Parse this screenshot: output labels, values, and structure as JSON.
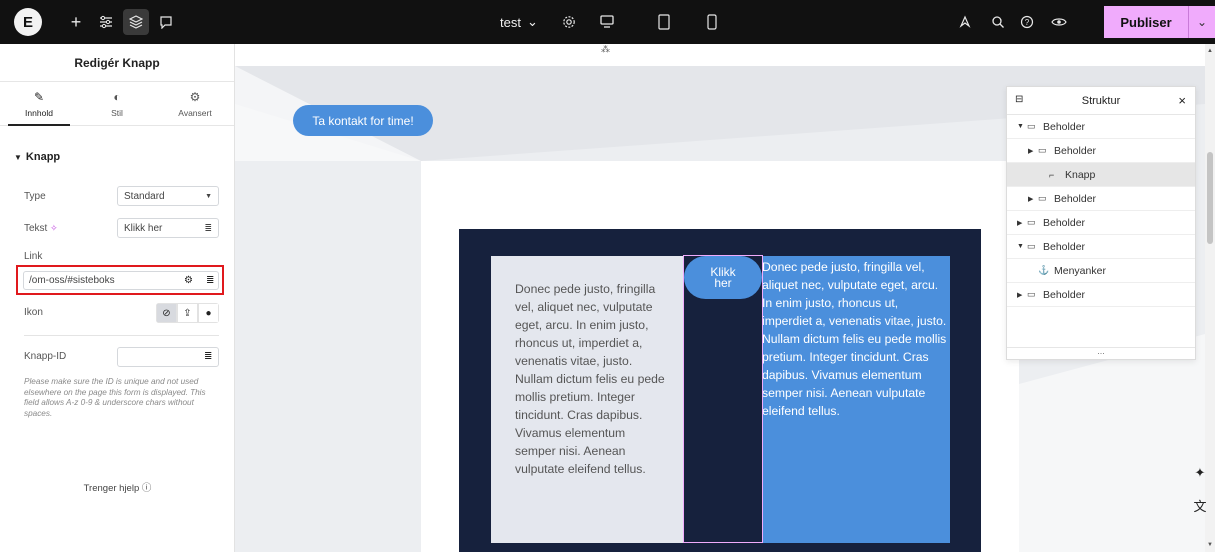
{
  "topbar": {
    "site_name": "test",
    "publish_label": "Publiser",
    "icons": [
      "elementor-logo-icon",
      "add-icon",
      "settings-sliders-icon",
      "layers-icon",
      "comments-icon",
      "gear-icon",
      "desktop-icon",
      "tablet-icon",
      "mobile-icon",
      "notes-icon",
      "search-icon",
      "help-icon",
      "preview-icon"
    ]
  },
  "panel": {
    "title": "Redigér Knapp",
    "tabs": [
      {
        "label": "Innhold",
        "icon": "pencil-icon"
      },
      {
        "label": "Stil",
        "icon": "half-circle-icon"
      },
      {
        "label": "Avansert",
        "icon": "gear-icon"
      }
    ],
    "section": "Knapp",
    "type_label": "Type",
    "type_value": "Standard",
    "tekst_label": "Tekst",
    "tekst_value": "Klikk her",
    "link_label": "Link",
    "link_value": "/om-oss/#sisteboks",
    "ikon_label": "Ikon",
    "knapp_id_label": "Knapp-ID",
    "hint": "Please make sure the ID is unique and not used elsewhere on the page this form is displayed. This field allows A-z 0-9 & underscore chars without spaces.",
    "help": "Trenger hjelp"
  },
  "canvas": {
    "cta_label": "Ta kontakt for time!",
    "klikk_label_line1": "Klikk",
    "klikk_label_line2": "her",
    "left_text": "Donec pede justo, fringilla vel, aliquet nec, vulputate eget, arcu. In enim justo, rhoncus ut, imperdiet a, venenatis vitae, justo. Nullam dictum felis eu pede mollis pretium. Integer tincidunt. Cras dapibus. Vivamus elementum semper nisi. Aenean vulputate eleifend tellus.",
    "right_text": "Donec pede justo, fringilla vel, aliquet nec, vulputate eget, arcu. In enim justo, rhoncus ut, imperdiet a, venenatis vitae, justo. Nullam dictum felis eu pede mollis pretium. Integer tincidunt. Cras dapibus. Vivamus elementum semper nisi. Aenean vulputate eleifend tellus."
  },
  "structure": {
    "title": "Struktur",
    "rows": [
      {
        "label": "Beholder",
        "indent": 0,
        "arrow": "down",
        "icon": "container-icon"
      },
      {
        "label": "Beholder",
        "indent": 1,
        "arrow": "right",
        "icon": "container-icon"
      },
      {
        "label": "Knapp",
        "indent": 2,
        "arrow": "",
        "icon": "button-icon",
        "selected": true
      },
      {
        "label": "Beholder",
        "indent": 1,
        "arrow": "right",
        "icon": "container-icon"
      },
      {
        "label": "Beholder",
        "indent": 0,
        "arrow": "right",
        "icon": "container-icon"
      },
      {
        "label": "Beholder",
        "indent": 0,
        "arrow": "down",
        "icon": "container-icon"
      },
      {
        "label": "Menyanker",
        "indent": 1,
        "arrow": "",
        "icon": "anchor-icon"
      },
      {
        "label": "Beholder",
        "indent": 0,
        "arrow": "right",
        "icon": "container-icon"
      }
    ],
    "footer": "..."
  },
  "colors": {
    "topbar": "#111111",
    "publish": "#f0abfc",
    "accent_blue": "#4b8fdc",
    "dark_block": "#16213d",
    "highlight_red": "#e0191d"
  }
}
